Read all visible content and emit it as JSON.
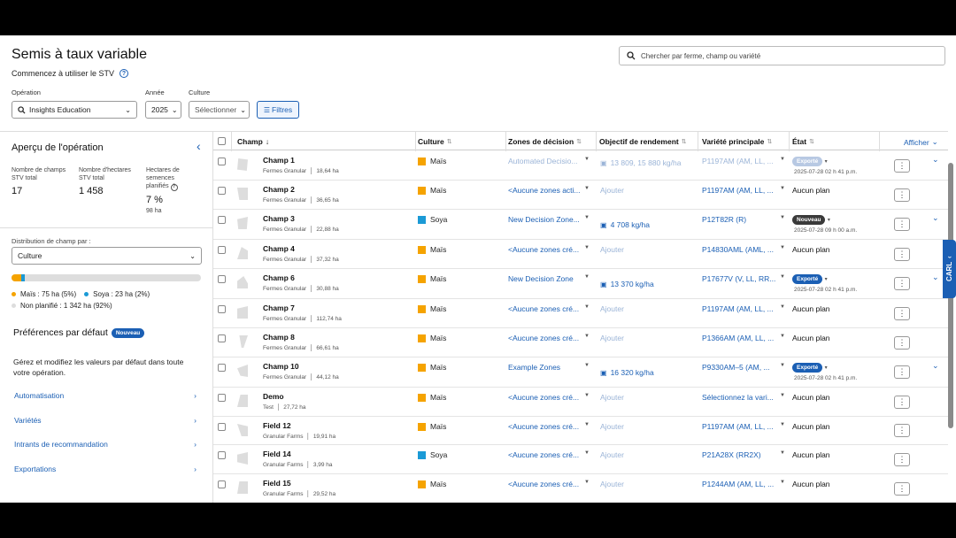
{
  "header": {
    "title": "Semis à taux variable",
    "subtitle": "Commencez à utiliser le STV",
    "search_placeholder": "Chercher par ferme, champ ou variété"
  },
  "filters": {
    "operation_label": "Opération",
    "operation_value": "Insights Education",
    "year_label": "Année",
    "year_value": "2025",
    "culture_label": "Culture",
    "culture_value": "Sélectionner",
    "filters_button": "Filtres"
  },
  "sidebar": {
    "title": "Aperçu de l'opération",
    "stats": [
      {
        "label": "Nombre de champs STV total",
        "value": "17"
      },
      {
        "label": "Nombre d'hectares STV total",
        "value": "1 458"
      },
      {
        "label": "Hectares de semences planifiés",
        "value": "7 %",
        "sub": "98 ha"
      }
    ],
    "distribution_label": "Distribution de champ par :",
    "distribution_value": "Culture",
    "legend": {
      "mais": "Maïs : 75 ha (5%)",
      "soya": "Soya : 23 ha (2%)",
      "nonplan": "Non planifié : 1 342 ha (92%)"
    },
    "distribution_fractions": {
      "mais": 0.05,
      "soya": 0.02,
      "nonplan": 0.92
    },
    "prefs_title": "Préférences par défaut",
    "prefs_badge": "Nouveau",
    "prefs_desc": "Gérez et modifiez les valeurs par défaut dans toute votre opération.",
    "links": [
      "Automatisation",
      "Variétés",
      "Intrants de recommandation",
      "Exportations"
    ]
  },
  "table": {
    "columns": {
      "champ": "Champ",
      "culture": "Culture",
      "zones": "Zones de décision",
      "objectif": "Objectif de rendement",
      "variete": "Variété principale",
      "etat": "État",
      "afficher": "Afficher"
    },
    "rows": [
      {
        "name": "Champ 1",
        "farm": "Fermes Granular",
        "area": "18,64 ha",
        "culture": "Maïs",
        "zone": "Automated Decisio...",
        "zone_dim": true,
        "objectif": "13 809, 15 880 kg/ha",
        "obj_dim": true,
        "variete": "P1197AM (AM, LL, ...",
        "var_dim": true,
        "etat": "Exporté",
        "etat_type": "exp_dim",
        "date": "2025-07-28 02 h 41 p.m.",
        "expand": true
      },
      {
        "name": "Champ 2",
        "farm": "Fermes Granular",
        "area": "36,65 ha",
        "culture": "Maïs",
        "zone": "<Aucune zones acti...",
        "objectif": "Ajouter",
        "variete": "P1197AM (AM, LL, ...",
        "etat": "Aucun plan"
      },
      {
        "name": "Champ 3",
        "farm": "Fermes Granular",
        "area": "22,88 ha",
        "culture": "Soya",
        "zone": "New Decision Zone...",
        "objectif": "4 708 kg/ha",
        "variete": "P12T82R (R)",
        "etat": "Nouveau",
        "etat_type": "new",
        "date": "2025-07-28 09 h 00 a.m.",
        "expand": true
      },
      {
        "name": "Champ 4",
        "farm": "Fermes Granular",
        "area": "37,32 ha",
        "culture": "Maïs",
        "zone": "<Aucune zones cré...",
        "objectif": "Ajouter",
        "variete": "P14830AML (AML, ...",
        "etat": "Aucun plan"
      },
      {
        "name": "Champ 6",
        "farm": "Fermes Granular",
        "area": "30,88 ha",
        "culture": "Maïs",
        "zone": "New Decision Zone",
        "objectif": "13 370 kg/ha",
        "variete": "P17677V (V, LL, RR...",
        "etat": "Exporté",
        "etat_type": "exp",
        "date": "2025-07-28 02 h 41 p.m.",
        "expand": true
      },
      {
        "name": "Champ 7",
        "farm": "Fermes Granular",
        "area": "112,74 ha",
        "culture": "Maïs",
        "zone": "<Aucune zones cré...",
        "objectif": "Ajouter",
        "variete": "P1197AM (AM, LL, ...",
        "etat": "Aucun plan"
      },
      {
        "name": "Champ 8",
        "farm": "Fermes Granular",
        "area": "66,61 ha",
        "culture": "Maïs",
        "zone": "<Aucune zones cré...",
        "objectif": "Ajouter",
        "variete": "P1366AM (AM, LL, ...",
        "etat": "Aucun plan"
      },
      {
        "name": "Champ 10",
        "farm": "Fermes Granular",
        "area": "44,12 ha",
        "culture": "Maïs",
        "zone": "Example Zones",
        "objectif": "16 320 kg/ha",
        "variete": "P9330AM–5 (AM, ...",
        "etat": "Exporté",
        "etat_type": "exp",
        "date": "2025-07-28 02 h 41 p.m.",
        "expand": true
      },
      {
        "name": "Demo",
        "farm": "Test",
        "area": "27,72 ha",
        "culture": "Maïs",
        "zone": "<Aucune zones cré...",
        "objectif": "Ajouter",
        "variete": "Sélectionnez la vari...",
        "etat": "Aucun plan"
      },
      {
        "name": "Field 12",
        "farm": "Granular Farms",
        "area": "19,91 ha",
        "culture": "Maïs",
        "zone": "<Aucune zones cré...",
        "objectif": "Ajouter",
        "variete": "P1197AM (AM, LL, ...",
        "etat": "Aucun plan"
      },
      {
        "name": "Field 14",
        "farm": "Granular Farms",
        "area": "3,99 ha",
        "culture": "Soya",
        "zone": "<Aucune zones cré...",
        "objectif": "Ajouter",
        "variete": "P21A28X (RR2X)",
        "etat": "Aucun plan"
      },
      {
        "name": "Field 15",
        "farm": "Granular Farms",
        "area": "29,52 ha",
        "culture": "Maïs",
        "zone": "<Aucune zones cré...",
        "objectif": "Ajouter",
        "variete": "P1244AM (AM, LL, ...",
        "etat": "Aucun plan"
      }
    ]
  },
  "colors": {
    "accent": "#1b5fb4",
    "mais": "#f5a300",
    "soya": "#1b9ad6"
  },
  "carl": "CARL"
}
